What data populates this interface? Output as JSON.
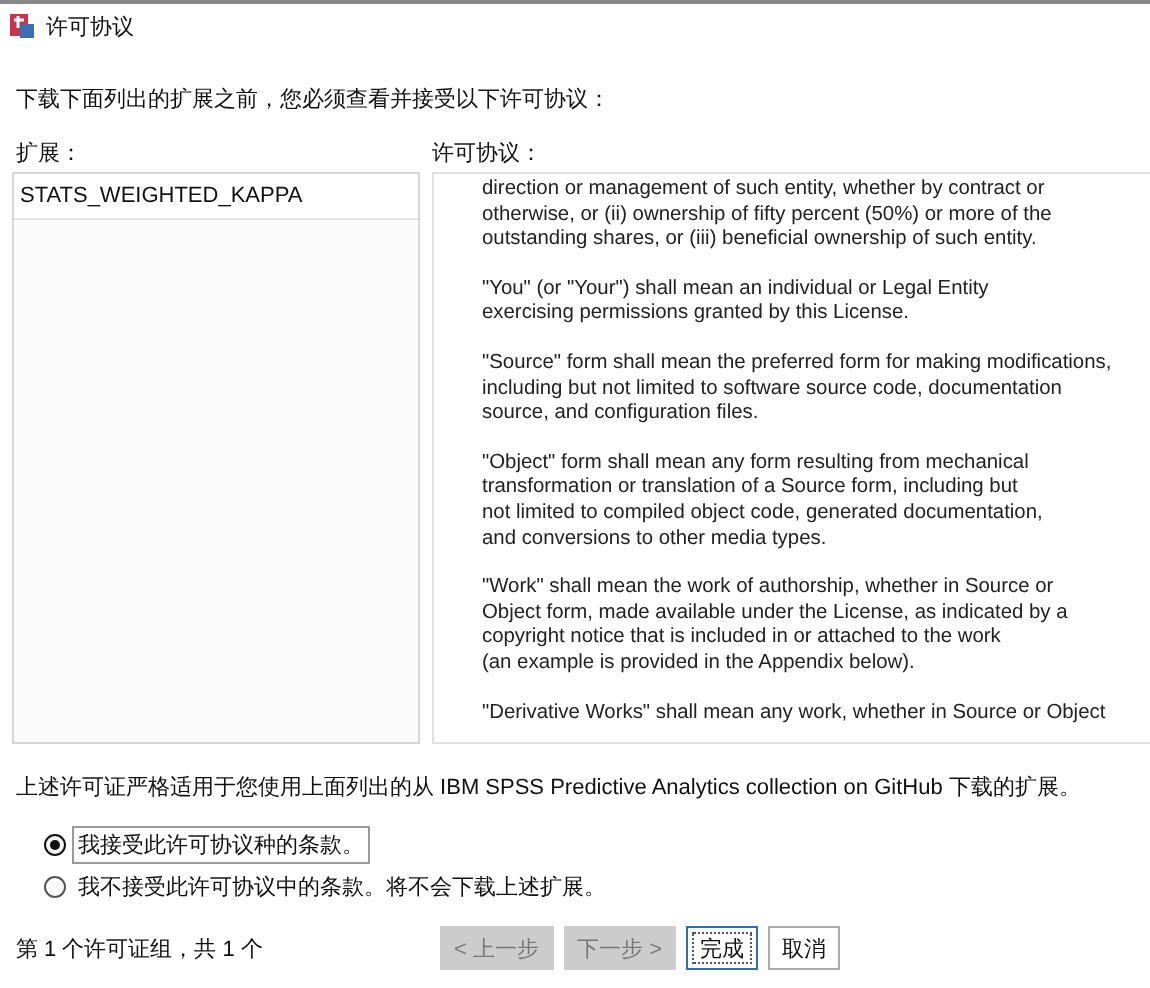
{
  "window": {
    "title": "许可协议"
  },
  "intro": "下载下面列出的扩展之前，您必须查看并接受以下许可协议：",
  "extensions": {
    "label": "扩展：",
    "items": [
      {
        "name": "STATS_WEIGHTED_KAPPA",
        "selected": false
      }
    ]
  },
  "license": {
    "label": "许可协议：",
    "paragraphs": [
      [
        "direction or management of such entity, whether by contract or",
        "otherwise, or (ii) ownership of fifty percent (50%) or more of the",
        "outstanding shares, or (iii) beneficial ownership of such entity."
      ],
      [
        "\"You\" (or \"Your\") shall mean an individual or Legal Entity",
        "exercising permissions granted by this License."
      ],
      [
        "\"Source\" form shall mean the preferred form for making modifications,",
        "including but not limited to software source code, documentation",
        "source, and configuration files."
      ],
      [
        "\"Object\" form shall mean any form resulting from mechanical",
        "transformation or translation of a Source form, including but",
        "not limited to compiled object code, generated documentation,",
        "and conversions to other media types."
      ],
      [
        "\"Work\" shall mean the work of authorship, whether in Source or",
        "Object form, made available under the License, as indicated by a",
        "copyright notice that is included in or attached to the work",
        "(an example is provided in the Appendix below)."
      ],
      [
        "\"Derivative Works\" shall mean any work, whether in Source or Object"
      ]
    ]
  },
  "note": "上述许可证严格适用于您使用上面列出的从 IBM SPSS Predictive Analytics collection on GitHub 下载的扩展。",
  "options": [
    {
      "label": "我接受此许可协议种的条款。",
      "selected": true
    },
    {
      "label": "我不接受此许可协议中的条款。将不会下载上述扩展。",
      "selected": false
    }
  ],
  "footer": {
    "status": "第 1 个许可证组，共 1 个",
    "buttons": [
      {
        "label": "< 上一步",
        "disabled": true,
        "focused": false
      },
      {
        "label": "下一步 >",
        "disabled": true,
        "focused": false
      },
      {
        "label": "完成",
        "disabled": false,
        "focused": true
      },
      {
        "label": "取消",
        "disabled": false,
        "focused": false
      }
    ]
  }
}
